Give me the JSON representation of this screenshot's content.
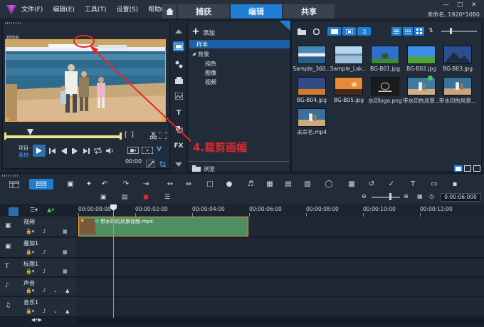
{
  "app": {
    "menu": [
      "文件(F)",
      "编辑(E)",
      "工具(T)",
      "设置(S)",
      "帮助(H)"
    ],
    "tabs": [
      {
        "label": "捕获",
        "active": false
      },
      {
        "label": "编辑",
        "active": true
      },
      {
        "label": "共享",
        "active": false
      }
    ],
    "project_info": "未命名, 1920*1080",
    "accent": "#1f7ed3"
  },
  "player": {
    "video_label": "视频名",
    "mode_project": "项目-",
    "mode_clip": "素材-",
    "timecode": "00:00"
  },
  "library": {
    "add_label": "添加",
    "tree": {
      "selected": "样本",
      "background": "背景",
      "children": [
        "纯色",
        "图像",
        "视频"
      ]
    },
    "browse_label": "浏览",
    "thumbnails": [
      {
        "label": "Sample_360...",
        "kind": "harbor"
      },
      {
        "label": "Sample_Lak...",
        "kind": "lake"
      },
      {
        "label": "BG-B01.jpg",
        "kind": "tree-blue"
      },
      {
        "label": "BG-B02.jpg",
        "kind": "field-green"
      },
      {
        "label": "BG-B03.jpg",
        "kind": "mountain"
      },
      {
        "label": "BG-B04.jpg",
        "kind": "desert"
      },
      {
        "label": "BG-B05.jpg",
        "kind": "sunset"
      },
      {
        "label": "水印logo.png",
        "kind": "logo"
      },
      {
        "label": "带水印的风景...",
        "kind": "family"
      },
      {
        "label": "带水印的风景...",
        "kind": "family2"
      },
      {
        "label": "未命名.mp4",
        "kind": "family3"
      }
    ]
  },
  "annotation": {
    "text": "4.裁剪画幅",
    "color": "#e8262a"
  },
  "timeline": {
    "ruler": [
      "00:00:00:00",
      "00:00:02:00",
      "00:00:04:00",
      "00:00:06:00",
      "00:00:08:00",
      "00:00:10:00",
      "00:00:12:00"
    ],
    "timecode": "0:00:06:000",
    "tracks": [
      "视频",
      "叠加1",
      "标题1",
      "声音",
      "音乐1"
    ],
    "clip_label": "带水印的风景视频.mp4"
  }
}
